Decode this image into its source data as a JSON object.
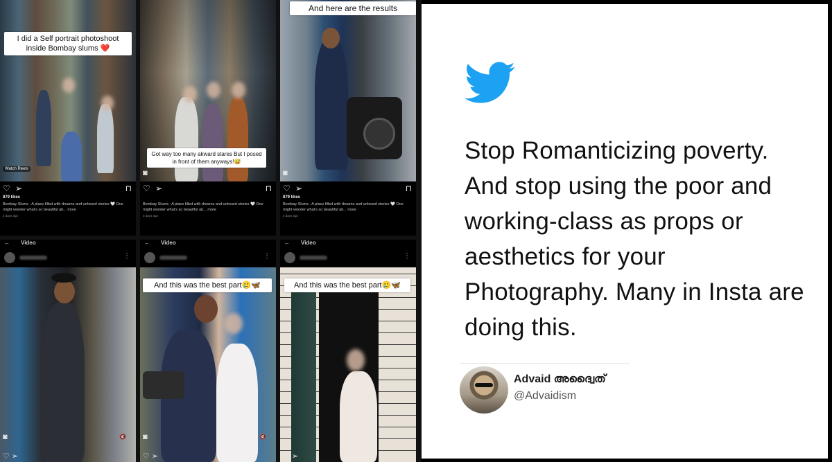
{
  "panels": [
    {
      "caption": "I did a Self portrait photoshoot inside Bombay slums ❤️",
      "chip": "Watch Reels",
      "likes": "879 likes",
      "description": "Bombay Slums : A place filled with dreams and unheard stories 🤍 One might wonder what's so beautiful ab... more",
      "date": "2 days ago"
    },
    {
      "caption": "Got way too many akward stares But I posed in front of them anyways!😅",
      "likes": "",
      "description": "Bombay Slums : A place filled with dreams and unheard stories 🤍 One might wonder what's so beautiful ab... more",
      "date": "3 days ago"
    },
    {
      "caption": "And here are the results",
      "likes": "879 likes",
      "description": "Bombay Slums : A place filled with dreams and unheard stories 🤍 One might wonder what's so beautiful ab... more",
      "date": "3 days ago"
    },
    {
      "topbar": "Video",
      "caption": ""
    },
    {
      "topbar": "Video",
      "caption": "And this was the best part🥲🦋"
    },
    {
      "topbar": "Video",
      "caption": "And this was the best part🥲🦋"
    }
  ],
  "tweet": {
    "text": "Stop Romanticizing poverty. And stop using the poor and working-class as props or aesthetics for your Photography. Many in Insta are doing this.",
    "display_name": "Advaid അദ്വൈത്",
    "handle": "@Advaidism"
  },
  "colors": {
    "twitter_blue": "#1DA1F2"
  },
  "icons": [
    "heart-icon",
    "share-icon",
    "bookmark-icon",
    "back-arrow-icon",
    "more-icon",
    "mute-icon",
    "camera-icon",
    "twitter-bird-icon"
  ]
}
